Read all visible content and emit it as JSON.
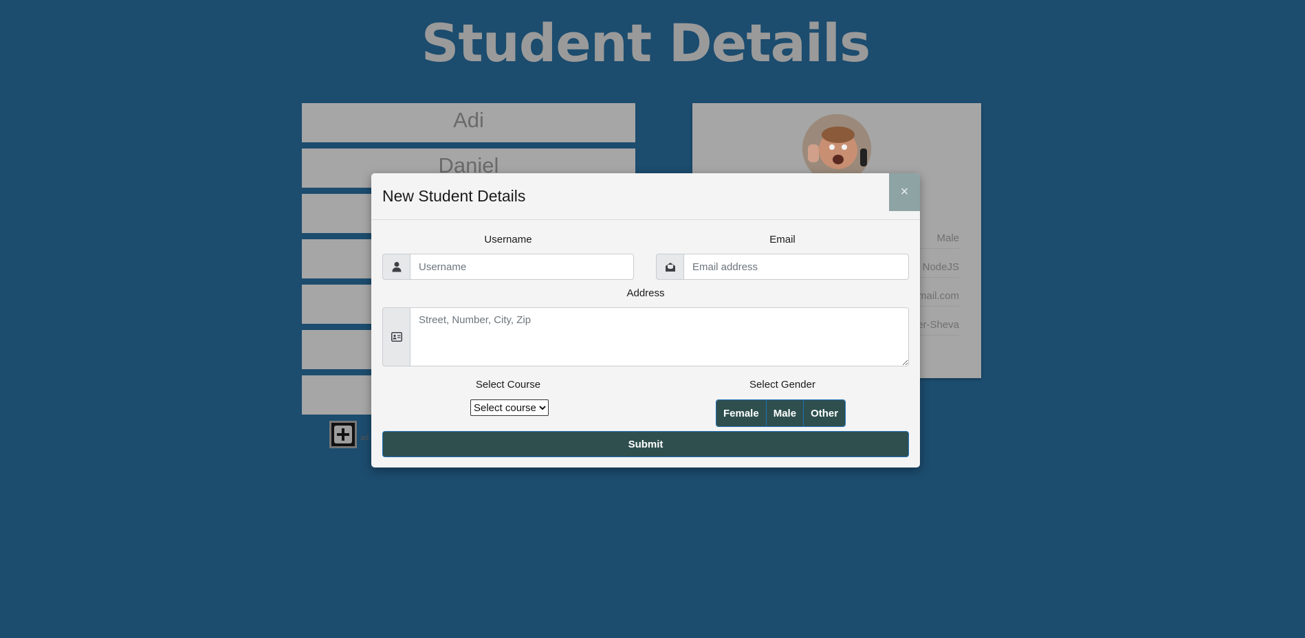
{
  "page": {
    "title": "Student Details"
  },
  "students": [
    {
      "name": "Adi"
    },
    {
      "name": "Daniel"
    },
    {
      "name": ""
    },
    {
      "name": ""
    },
    {
      "name": ""
    },
    {
      "name": ""
    },
    {
      "name": ""
    }
  ],
  "add_button": {
    "label": "ad"
  },
  "detail_card": {
    "gender": "Male",
    "course": "NodeJS",
    "email": "mail.com",
    "address": "er-Sheva"
  },
  "modal": {
    "title": "New Student Details",
    "close_label": "×",
    "username": {
      "label": "Username",
      "placeholder": "Username",
      "value": ""
    },
    "email": {
      "label": "Email",
      "placeholder": "Email address",
      "value": ""
    },
    "address": {
      "label": "Address",
      "placeholder": "Street, Number, City, Zip",
      "value": ""
    },
    "course": {
      "label": "Select Course",
      "selected": "Select course"
    },
    "gender": {
      "label": "Select Gender",
      "options": [
        "Female",
        "Male",
        "Other"
      ]
    },
    "submit_label": "Submit"
  },
  "colors": {
    "page_background": "#1c4c6e",
    "primary_button": "#2f4f4f",
    "button_border": "#1f6fb5",
    "close_button": "#8ea3a3"
  }
}
